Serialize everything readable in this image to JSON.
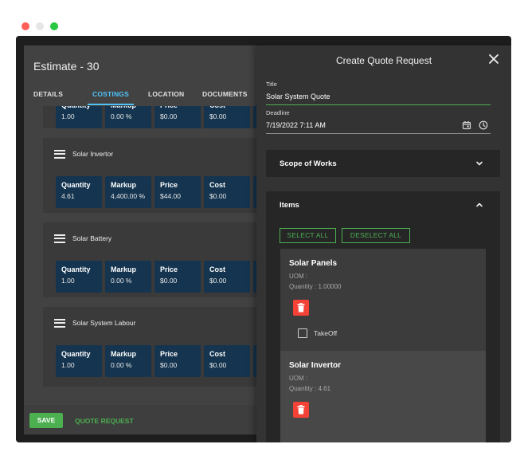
{
  "window_controls": {
    "close_color": "#ff5f57",
    "minimize_color": "#e6e6e6",
    "maximize_color": "#28c840"
  },
  "estimate": {
    "title": "Estimate - 30",
    "tabs": [
      {
        "label": "DETAILS",
        "active": false
      },
      {
        "label": "COSTINGS",
        "active": true
      },
      {
        "label": "LOCATION",
        "active": false
      },
      {
        "label": "DOCUMENTS",
        "active": false
      }
    ],
    "field_labels": {
      "quantity": "Quantity",
      "markup": "Markup",
      "price": "Price",
      "cost": "Cost"
    },
    "partial_group": {
      "quantity": "1.00",
      "markup": "0.00 %",
      "price": "$0.00",
      "cost": "$0.00"
    },
    "groups": [
      {
        "name": "Solar Invertor",
        "quantity": "4.61",
        "markup": "4,400.00 %",
        "price": "$44.00",
        "cost": "$0.00"
      },
      {
        "name": "Solar Battery",
        "quantity": "1.00",
        "markup": "0.00 %",
        "price": "$0.00",
        "cost": "$0.00"
      },
      {
        "name": "Solar System Labour",
        "quantity": "1.00",
        "markup": "0.00 %",
        "price": "$0.00",
        "cost": "$0.00"
      }
    ],
    "actions": {
      "save_label": "SAVE",
      "quote_request_label": "QUOTE REQUEST"
    }
  },
  "quote_request": {
    "title": "Create Quote Request",
    "title_field": {
      "label": "Title",
      "value": "Solar System Quote"
    },
    "deadline_field": {
      "label": "Deadline",
      "value": "7/19/2022 7:11 AM"
    },
    "scope_panel": {
      "title": "Scope of Works",
      "expanded": false
    },
    "items_panel": {
      "title": "Items",
      "expanded": true,
      "select_all_label": "SELECT ALL",
      "deselect_all_label": "DESELECT ALL",
      "items": [
        {
          "name": "Solar Panels",
          "uom": "UOM :",
          "quantity": "Quantity : 1.00000",
          "takeoff_label": "TakeOff",
          "takeoff_checked": false
        },
        {
          "name": "Solar Invertor",
          "uom": "UOM :",
          "quantity": "Quantity : 4.61"
        }
      ]
    }
  },
  "colors": {
    "accent_green": "#4caf50",
    "accent_blue": "#4fc3f7",
    "card_blue": "#14344f",
    "delete_red": "#f44336"
  },
  "icons": [
    "hamburger-icon",
    "close-icon",
    "calendar-icon",
    "clock-icon",
    "chevron-down-icon",
    "chevron-up-icon",
    "trash-icon",
    "checkbox-icon"
  ]
}
